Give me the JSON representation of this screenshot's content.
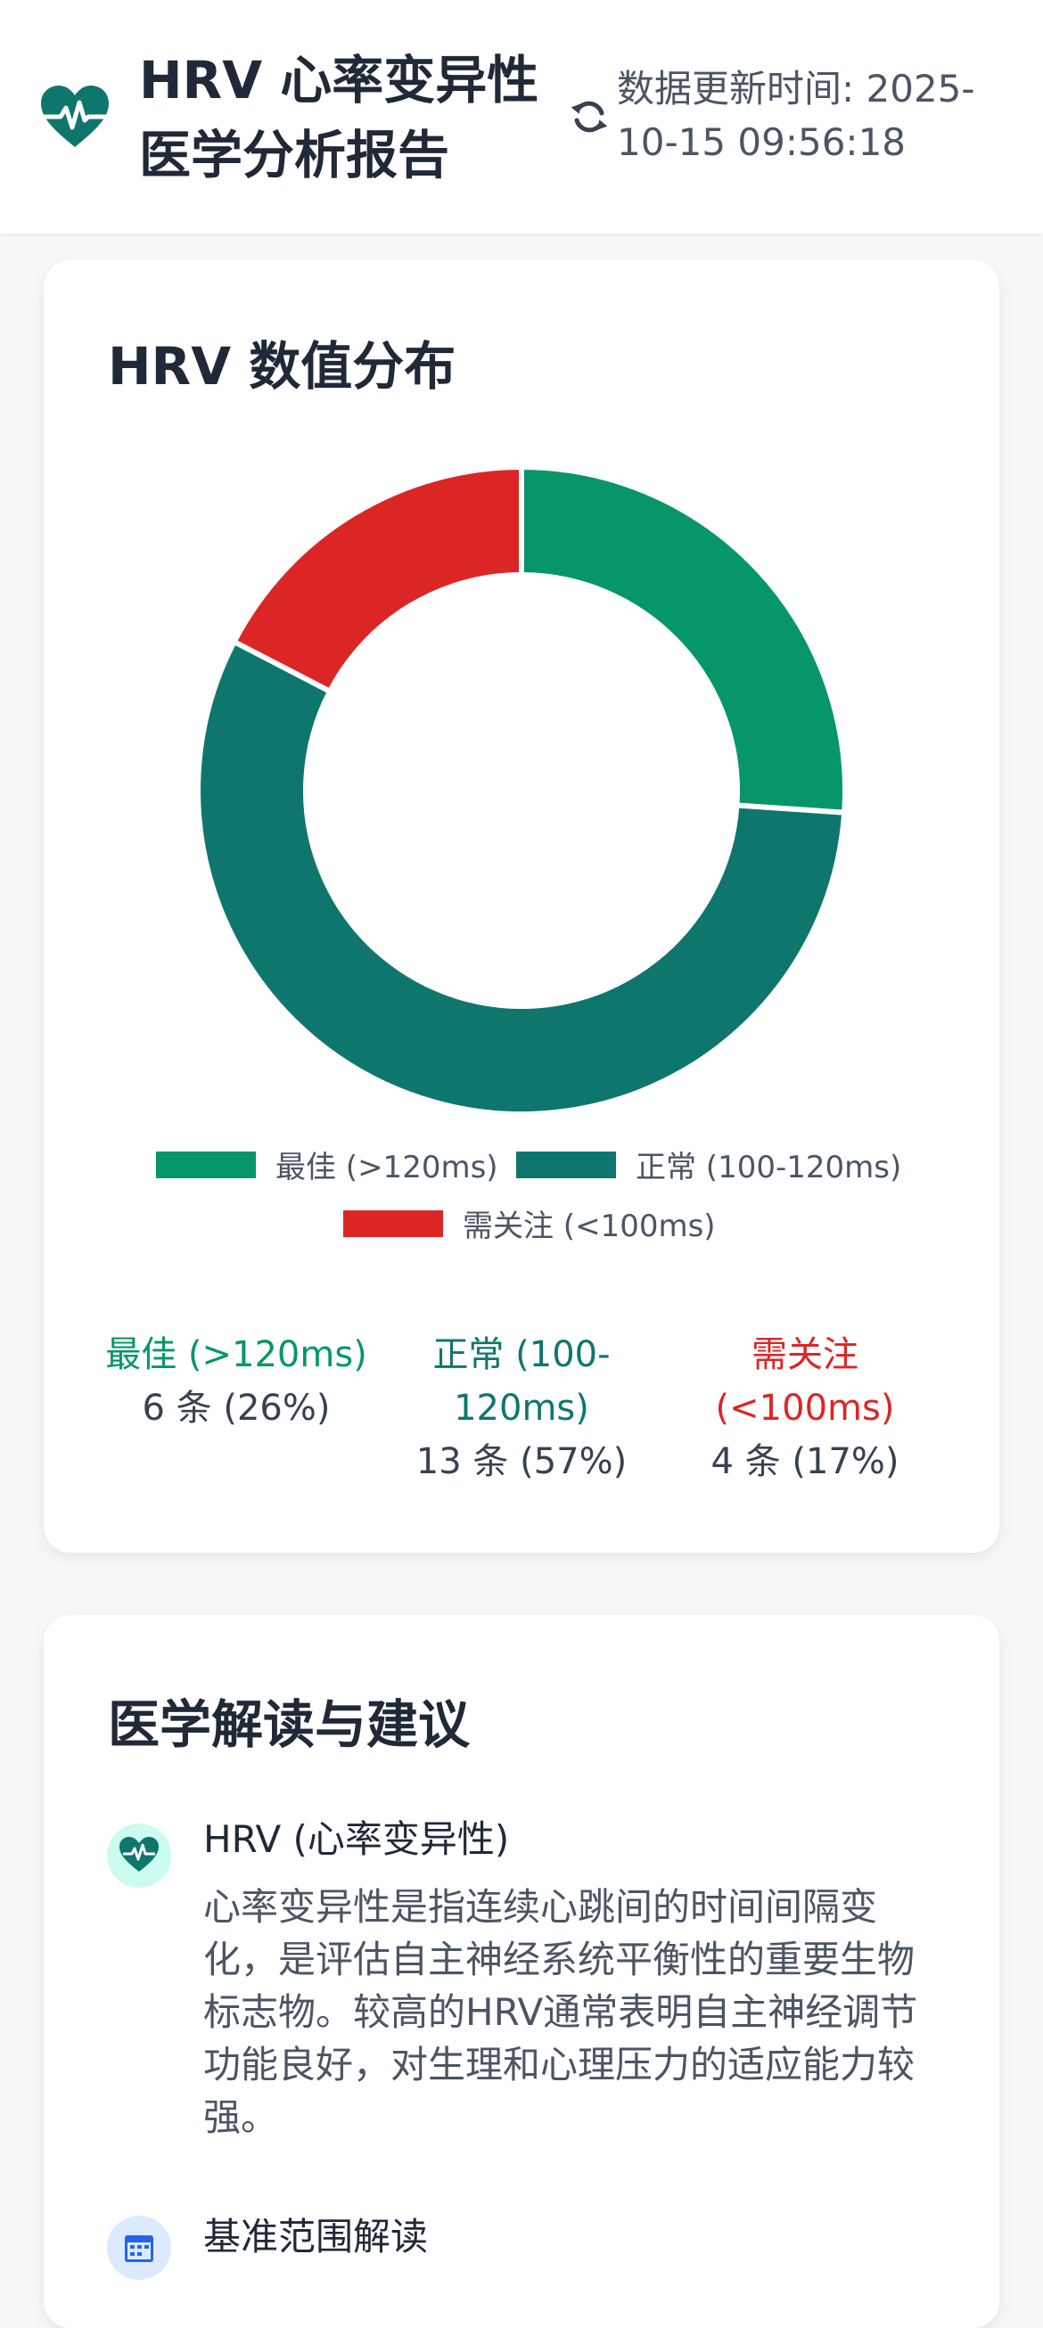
{
  "header": {
    "title": "HRV 心率变异性医学分析报告",
    "update_label": "数据更新时间: 2025-10-15 09:56:18",
    "logo_icon": "heart-pulse-icon",
    "refresh_icon": "refresh-icon"
  },
  "distribution": {
    "title": "HRV 数值分布",
    "chart_data": {
      "type": "pie",
      "donut": true,
      "categories": [
        "最佳 (>120ms)",
        "正常 (100-120ms)",
        "需关注 (<100ms)"
      ],
      "values": [
        6,
        13,
        4
      ],
      "colors": [
        "#079669",
        "#0f766e",
        "#dc2626"
      ],
      "legend_position": "bottom"
    },
    "stats": [
      {
        "label": "最佳 (>120ms)",
        "count": "6 条 (26%)",
        "color": "#079669"
      },
      {
        "label": "正常 (100-120ms)",
        "count": "13 条 (57%)",
        "color": "#0f766e"
      },
      {
        "label": "需关注 (<100ms)",
        "count": "4 条 (17%)",
        "color": "#dc2626"
      }
    ]
  },
  "advice": {
    "title": "医学解读与建议",
    "items": [
      {
        "icon": "heart-pulse-icon",
        "title": "HRV (心率变异性)",
        "body": "心率变异性是指连续心跳间的时间间隔变化，是评估自主神经系统平衡性的重要生物标志物。较高的HRV通常表明自主神经调节功能良好，对生理和心理压力的适应能力较强。"
      },
      {
        "icon": "calendar-icon",
        "title": "基准范围解读",
        "body": ""
      }
    ]
  }
}
